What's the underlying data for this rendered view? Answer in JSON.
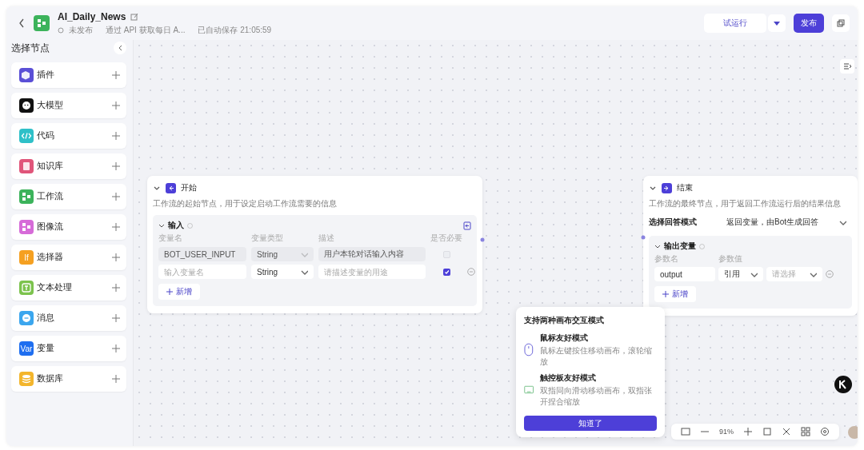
{
  "header": {
    "title": "AI_Daily_News",
    "status": "未发布",
    "description": "通过 API 获取每日 A...",
    "saved": "已自动保存 21:05:59",
    "run_button": "试运行",
    "publish_button": "发布"
  },
  "sidebar": {
    "title": "选择节点",
    "items": [
      {
        "label": "插件",
        "kind": "plugin",
        "color": "#5a4fd6"
      },
      {
        "label": "大模型",
        "kind": "model",
        "color": "#111111"
      },
      {
        "label": "代码",
        "kind": "code",
        "color": "#2fc0c8"
      },
      {
        "label": "知识库",
        "kind": "knowledge",
        "color": "#e0557a"
      },
      {
        "label": "工作流",
        "kind": "workflow",
        "color": "#3cb35b"
      },
      {
        "label": "图像流",
        "kind": "image",
        "color": "#d66bd8"
      },
      {
        "label": "选择器",
        "kind": "text",
        "icon_text": "If",
        "color": "#f5a021"
      },
      {
        "label": "文本处理",
        "kind": "textproc",
        "color": "#7cc34d"
      },
      {
        "label": "消息",
        "kind": "message",
        "color": "#3ba6ee"
      },
      {
        "label": "变量",
        "kind": "text",
        "icon_text": "Var",
        "color": "#1e6ef0"
      },
      {
        "label": "数据库",
        "kind": "database",
        "color": "#f3b52c"
      }
    ]
  },
  "start_node": {
    "title": "开始",
    "description": "工作流的起始节点，用于设定启动工作流需要的信息",
    "section": "输入",
    "columns": [
      "变量名",
      "变量类型",
      "描述",
      "是否必要"
    ],
    "rows": [
      {
        "name": "BOT_USER_INPUT",
        "type": "String",
        "description": "用户本轮对话输入内容",
        "locked": true,
        "required": false
      },
      {
        "name_placeholder": "输入变量名",
        "type": "String",
        "description_placeholder": "请描述变量的用途",
        "locked": false,
        "required": true
      }
    ],
    "add_button": "新增"
  },
  "end_node": {
    "title": "结束",
    "description": "工作流的最终节点，用于返回工作流运行后的结果信息",
    "mode_label": "选择回答模式",
    "mode_value": "返回变量，由Bot生成回答",
    "section": "输出变量",
    "columns": [
      "参数名",
      "参数值"
    ],
    "rows": [
      {
        "name": "output",
        "source": "引用",
        "value_placeholder": "请选择"
      }
    ],
    "add_button": "新增"
  },
  "popup": {
    "title": "支持两种画布交互模式",
    "modes": [
      {
        "kind": "mouse",
        "title": "鼠标友好模式",
        "description": "鼠标左键按住移动画布，滚轮缩放"
      },
      {
        "kind": "trackpad",
        "title": "触控板友好模式",
        "description": "双指同向滑动移动画布，双指张开捏合缩放"
      }
    ],
    "button": "知道了"
  },
  "toolbar": {
    "zoom": "91%"
  }
}
